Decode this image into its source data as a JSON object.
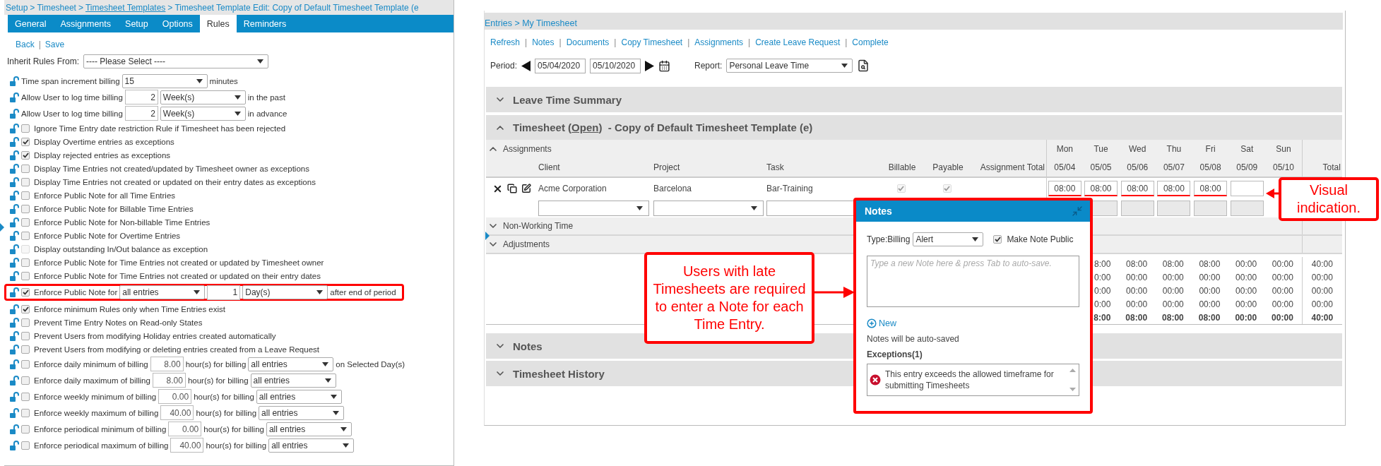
{
  "rules_panel": {
    "breadcrumb": {
      "separator": ">",
      "items": [
        {
          "text": "Setup",
          "link": false
        },
        {
          "text": "Timesheet",
          "link": false
        },
        {
          "text": "Timesheet Templates",
          "link": true
        },
        {
          "text": "Timesheet Template Edit: Copy of Default Timesheet Template (e",
          "link": false
        }
      ]
    },
    "tabs": [
      {
        "label": "General",
        "selected": false
      },
      {
        "label": "Assignments",
        "selected": false
      },
      {
        "label": "Setup",
        "selected": false
      },
      {
        "label": "Options",
        "selected": false
      },
      {
        "label": "Rules",
        "selected": true
      },
      {
        "label": "Reminders",
        "selected": false
      }
    ],
    "actions": {
      "separator": "|",
      "items": [
        "Back",
        "Save"
      ]
    },
    "inherit": {
      "label": "Inherit Rules From:",
      "value": "---- Please Select ----"
    },
    "rules": [
      {
        "kind": "plain",
        "highlighted": false,
        "parts": [
          {
            "kind": "text",
            "text": "Time span increment billing"
          },
          {
            "kind": "select",
            "value": "15"
          },
          {
            "kind": "text",
            "text": "minutes"
          }
        ]
      },
      {
        "kind": "plain",
        "highlighted": false,
        "parts": [
          {
            "kind": "text",
            "text": "Allow User to log time billing"
          },
          {
            "kind": "number",
            "value": "2"
          },
          {
            "kind": "select",
            "value": "Week(s)"
          },
          {
            "kind": "text",
            "text": "in the past"
          }
        ]
      },
      {
        "kind": "plain",
        "highlighted": false,
        "parts": [
          {
            "kind": "text",
            "text": "Allow User to log time billing"
          },
          {
            "kind": "number",
            "value": "2"
          },
          {
            "kind": "select",
            "value": "Week(s)"
          },
          {
            "kind": "text",
            "text": "in advance"
          }
        ]
      },
      {
        "kind": "check",
        "checked": false,
        "disabled": false,
        "highlighted": false,
        "parts": [
          {
            "kind": "text",
            "text": "Ignore Time Entry date restriction Rule if Timesheet has been rejected"
          }
        ]
      },
      {
        "kind": "check",
        "checked": true,
        "disabled": false,
        "highlighted": false,
        "parts": [
          {
            "kind": "text",
            "text": "Display Overtime entries as exceptions"
          }
        ]
      },
      {
        "kind": "check",
        "checked": true,
        "disabled": false,
        "highlighted": false,
        "parts": [
          {
            "kind": "text",
            "text": "Display rejected entries as exceptions"
          }
        ]
      },
      {
        "kind": "check",
        "checked": false,
        "disabled": false,
        "highlighted": false,
        "parts": [
          {
            "kind": "text",
            "text": "Display Time Entries not created/updated by Timesheet owner as exceptions"
          }
        ]
      },
      {
        "kind": "check",
        "checked": false,
        "disabled": false,
        "highlighted": false,
        "parts": [
          {
            "kind": "text",
            "text": "Display Time Entries not created or updated on their entry dates as exceptions"
          }
        ]
      },
      {
        "kind": "check",
        "checked": false,
        "disabled": false,
        "highlighted": false,
        "parts": [
          {
            "kind": "text",
            "text": "Enforce Public Note for all Time Entries"
          }
        ]
      },
      {
        "kind": "check",
        "checked": false,
        "disabled": false,
        "highlighted": false,
        "parts": [
          {
            "kind": "text",
            "text": "Enforce Public Note for Billable Time Entries"
          }
        ]
      },
      {
        "kind": "check",
        "checked": false,
        "disabled": false,
        "highlighted": false,
        "parts": [
          {
            "kind": "text",
            "text": "Enforce Public Note for Non-billable Time Entries"
          }
        ]
      },
      {
        "kind": "check",
        "checked": false,
        "disabled": false,
        "highlighted": false,
        "parts": [
          {
            "kind": "text",
            "text": "Enforce Public Note for Overtime Entries"
          }
        ]
      },
      {
        "kind": "check",
        "checked": false,
        "disabled": true,
        "highlighted": false,
        "parts": [
          {
            "kind": "text",
            "text": "Display outstanding In/Out balance as exception"
          }
        ]
      },
      {
        "kind": "check",
        "checked": false,
        "disabled": false,
        "highlighted": false,
        "parts": [
          {
            "kind": "text",
            "text": "Enforce Public Note for Time Entries not created or updated by Timesheet owner"
          }
        ]
      },
      {
        "kind": "check",
        "checked": false,
        "disabled": false,
        "highlighted": false,
        "parts": [
          {
            "kind": "text",
            "text": "Enforce Public Note for Time Entries not created or updated on their entry dates"
          }
        ]
      },
      {
        "kind": "check",
        "checked": true,
        "disabled": false,
        "highlighted": true,
        "parts": [
          {
            "kind": "text",
            "text": "Enforce Public Note for"
          },
          {
            "kind": "select",
            "value": "all entries"
          },
          {
            "kind": "number",
            "value": "1"
          },
          {
            "kind": "select",
            "value": "Day(s)"
          },
          {
            "kind": "text",
            "text": "after end of period"
          }
        ]
      },
      {
        "kind": "check",
        "checked": true,
        "disabled": false,
        "highlighted": false,
        "parts": [
          {
            "kind": "text",
            "text": "Enforce minimum Rules only when Time Entries exist"
          }
        ]
      },
      {
        "kind": "check",
        "checked": false,
        "disabled": false,
        "highlighted": false,
        "parts": [
          {
            "kind": "text",
            "text": "Prevent Time Entry Notes on Read-only States"
          }
        ]
      },
      {
        "kind": "check",
        "checked": false,
        "disabled": false,
        "highlighted": false,
        "parts": [
          {
            "kind": "text",
            "text": "Prevent Users from modifying Holiday entries created automatically"
          }
        ]
      },
      {
        "kind": "check",
        "checked": false,
        "disabled": false,
        "highlighted": false,
        "parts": [
          {
            "kind": "text",
            "text": "Prevent Users from modifying or deleting entries created from a Leave Request"
          }
        ]
      },
      {
        "kind": "check",
        "checked": false,
        "disabled": false,
        "highlighted": false,
        "parts": [
          {
            "kind": "text",
            "text": "Enforce daily minimum of billing"
          },
          {
            "kind": "number",
            "value": "8.00"
          },
          {
            "kind": "text",
            "text": "hour(s) for billing"
          },
          {
            "kind": "select",
            "value": "all entries"
          },
          {
            "kind": "text",
            "text": "on Selected Day(s)"
          }
        ]
      },
      {
        "kind": "check",
        "checked": false,
        "disabled": false,
        "highlighted": false,
        "parts": [
          {
            "kind": "text",
            "text": "Enforce daily maximum of billing"
          },
          {
            "kind": "number",
            "value": "8.00"
          },
          {
            "kind": "text",
            "text": "hour(s) for billing"
          },
          {
            "kind": "select",
            "value": "all entries"
          }
        ]
      },
      {
        "kind": "check",
        "checked": false,
        "disabled": false,
        "highlighted": false,
        "parts": [
          {
            "kind": "text",
            "text": "Enforce weekly minimum of billing"
          },
          {
            "kind": "number",
            "value": "0.00"
          },
          {
            "kind": "text",
            "text": "hour(s) for billing"
          },
          {
            "kind": "select",
            "value": "all entries"
          }
        ]
      },
      {
        "kind": "check",
        "checked": false,
        "disabled": false,
        "highlighted": false,
        "parts": [
          {
            "kind": "text",
            "text": "Enforce weekly maximum of billing"
          },
          {
            "kind": "number",
            "value": "40.00"
          },
          {
            "kind": "text",
            "text": "hour(s) for billing"
          },
          {
            "kind": "select",
            "value": "all entries"
          }
        ]
      },
      {
        "kind": "check",
        "checked": false,
        "disabled": false,
        "highlighted": false,
        "parts": [
          {
            "kind": "text",
            "text": "Enforce periodical minimum of billing"
          },
          {
            "kind": "number",
            "value": "0.00"
          },
          {
            "kind": "text",
            "text": "hour(s) for billing"
          },
          {
            "kind": "select",
            "value": "all entries"
          }
        ]
      },
      {
        "kind": "check",
        "checked": false,
        "disabled": false,
        "highlighted": false,
        "parts": [
          {
            "kind": "text",
            "text": "Enforce periodical maximum of billing"
          },
          {
            "kind": "number",
            "value": "40.00"
          },
          {
            "kind": "text",
            "text": "hour(s) for billing"
          },
          {
            "kind": "select",
            "value": "all entries"
          }
        ]
      }
    ]
  },
  "timesheet_panel": {
    "breadcrumb": "Entries > My Timesheet",
    "links": {
      "separator": "|",
      "items": [
        "Refresh",
        "Notes",
        "Documents",
        "Copy Timesheet",
        "Assignments",
        "Create Leave Request",
        "Complete"
      ]
    },
    "period": {
      "label": "Period:",
      "start": "05/04/2020",
      "end": "05/10/2020"
    },
    "report": {
      "label": "Report:",
      "value": "Personal Leave Time"
    },
    "sections_top": [
      {
        "title": "Leave Time Summary",
        "expanded": false
      }
    ],
    "timesheet": {
      "title": "Timesheet (",
      "status": "Open",
      "title_end": ")  - Copy of Default Timesheet Template (e)",
      "expanded": true,
      "assignments": {
        "title": "Assignments",
        "expanded": true,
        "columns": [
          "Client",
          "Project",
          "Task",
          "Billable",
          "Payable",
          "Assignment Total"
        ],
        "days": [
          {
            "day": "Mon",
            "date": "05/04"
          },
          {
            "day": "Tue",
            "date": "05/05"
          },
          {
            "day": "Wed",
            "date": "05/06"
          },
          {
            "day": "Thu",
            "date": "05/07"
          },
          {
            "day": "Fri",
            "date": "05/08"
          },
          {
            "day": "Sat",
            "date": "05/09"
          },
          {
            "day": "Sun",
            "date": "05/10"
          }
        ],
        "total_label": "Total",
        "rows": [
          {
            "client": "Acme Corporation",
            "project": "Barcelona",
            "task": "Bar-Training",
            "billable": true,
            "payable": true,
            "hours": [
              {
                "value": "08:00",
                "flagged": true
              },
              {
                "value": "08:00",
                "flagged": true
              },
              {
                "value": "08:00",
                "flagged": true
              },
              {
                "value": "08:00",
                "flagged": true
              },
              {
                "value": "08:00",
                "flagged": true
              },
              {
                "flagged": false
              }
            ]
          }
        ]
      },
      "groups": [
        {
          "title": "Non-Working Time",
          "expanded": false
        },
        {
          "title": "Adjustments",
          "expanded": false
        }
      ],
      "totals": [
        {
          "bold": false,
          "values": [
            "8:00",
            "08:00",
            "08:00",
            "08:00",
            "00:00",
            "00:00"
          ],
          "total": "40:00"
        },
        {
          "bold": false,
          "values": [
            "0:00",
            "00:00",
            "00:00",
            "00:00",
            "00:00",
            "00:00"
          ],
          "total": "00:00"
        },
        {
          "bold": false,
          "values": [
            "0:00",
            "00:00",
            "00:00",
            "00:00",
            "00:00",
            "00:00"
          ],
          "total": "00:00"
        },
        {
          "bold": false,
          "values": [
            "0:00",
            "00:00",
            "00:00",
            "00:00",
            "00:00",
            "00:00"
          ],
          "total": "00:00"
        },
        {
          "bold": true,
          "values": [
            "8:00",
            "08:00",
            "08:00",
            "08:00",
            "00:00",
            "00:00"
          ],
          "total": "40:00"
        }
      ]
    },
    "sections_bottom": [
      {
        "title": "Notes",
        "expanded": false
      },
      {
        "title": "Timesheet History",
        "expanded": false
      }
    ]
  },
  "notes_popup": {
    "title": "Notes",
    "type_label": "Type:Billing",
    "type_value": "Alert",
    "public": {
      "label": "Make Note Public",
      "checked": true
    },
    "placeholder": "Type a new Note here & press Tab to auto-save.",
    "new_label": "New",
    "autosave": "Notes will be auto-saved",
    "exceptions_title": "Exceptions(1)",
    "exceptions": [
      "This entry exceeds the allowed timeframe for submitting Timesheets"
    ]
  },
  "callouts": [
    {
      "text": "Visual indication."
    },
    {
      "text": "Users with late Timesheets are required to enter a Note for each Time Entry."
    }
  ]
}
